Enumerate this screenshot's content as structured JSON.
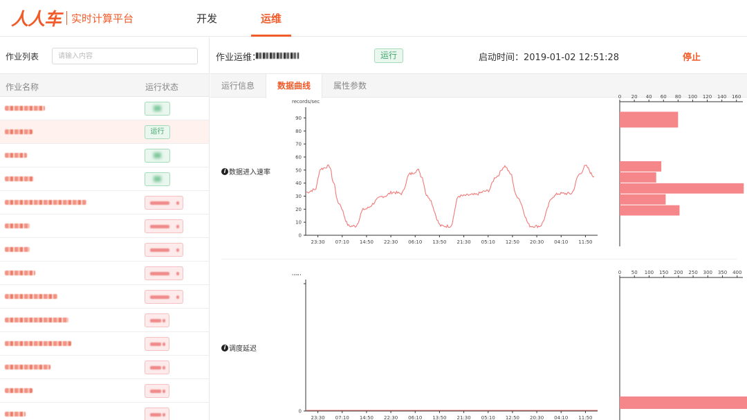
{
  "header": {
    "logo_mark": "人人车",
    "logo_text": "实时计算平台",
    "tabs": [
      {
        "label": "开发",
        "active": false
      },
      {
        "label": "运维",
        "active": true
      }
    ]
  },
  "sidebar": {
    "search_label": "作业列表",
    "search_placeholder": "请输入内容",
    "col_name": "作业名称",
    "col_status": "运行状态",
    "rows": [
      {
        "status": "running",
        "selected": false
      },
      {
        "status": "running",
        "label": "运行",
        "selected": true
      },
      {
        "status": "running",
        "selected": false
      },
      {
        "status": "running",
        "selected": false
      },
      {
        "status": "stopped",
        "selected": false
      },
      {
        "status": "stopped",
        "selected": false
      },
      {
        "status": "stopped",
        "selected": false
      },
      {
        "status": "stopped",
        "selected": false
      },
      {
        "status": "stopped",
        "selected": false
      },
      {
        "status": "stopped",
        "selected": false
      },
      {
        "status": "stopped",
        "selected": false
      },
      {
        "status": "stopped",
        "selected": false
      },
      {
        "status": "stopped",
        "selected": false
      },
      {
        "status": "stopped",
        "selected": false
      }
    ]
  },
  "job_info": {
    "title": "作业运维：",
    "status": "运行",
    "start_time": "启动时间：2019-01-02 12:51:28",
    "stop_label": "停止"
  },
  "sub_tabs": [
    {
      "label": "运行信息",
      "active": false
    },
    {
      "label": "数据曲线",
      "active": true
    },
    {
      "label": "属性参数",
      "active": false
    }
  ],
  "colors": {
    "accent": "#f05b2a",
    "line": "#f07878",
    "bar": "#f5868a",
    "success": "#3fa66b"
  },
  "chart_data": [
    {
      "type": "line",
      "title": "数据进入速率",
      "ylabel": "records/sec",
      "ylim": [
        0,
        95
      ],
      "yticks": [
        0,
        10,
        20,
        30,
        40,
        50,
        60,
        70,
        80,
        90
      ],
      "xticks": [
        "23:30",
        "07:10",
        "14:50",
        "22:30",
        "06:10",
        "13:50",
        "21:30",
        "05:10",
        "12:50",
        "20:30",
        "04:10",
        "11:50"
      ],
      "series": [
        {
          "x_keys": [
            0,
            3,
            5,
            8,
            9.5,
            11,
            15,
            17,
            20,
            27,
            30,
            33,
            36,
            39,
            40,
            42,
            47,
            50,
            53,
            58,
            63,
            66,
            69,
            71,
            73,
            78,
            81,
            86,
            87.5,
            92,
            95,
            97,
            100
          ],
          "values": [
            33,
            35,
            51,
            53,
            40,
            25,
            7,
            7,
            20,
            30,
            33,
            32,
            47,
            50,
            45,
            30,
            7,
            7,
            30,
            31,
            34,
            45,
            53,
            47,
            30,
            7,
            7,
            30,
            32,
            32,
            47,
            53,
            45
          ]
        }
      ]
    },
    {
      "type": "bar",
      "orientation": "horizontal",
      "xlim": [
        0,
        165
      ],
      "xticks": [
        0,
        20,
        40,
        60,
        80,
        100,
        120,
        140,
        160
      ],
      "y_bins": [
        [
          0,
          10
        ],
        [
          10,
          20
        ],
        [
          20,
          30
        ],
        [
          30,
          40
        ],
        [
          40,
          50
        ],
        [
          80,
          95
        ]
      ],
      "values": [
        82,
        63,
        170,
        50,
        57,
        80
      ]
    },
    {
      "type": "line",
      "title": "调度延迟",
      "ylabel": "min",
      "xticks": [
        "23:30",
        "07:10",
        "14:50",
        "22:30",
        "06:10",
        "13:50",
        "21:30",
        "05:10",
        "12:50",
        "20:30",
        "04:10",
        "11:50"
      ],
      "series": [
        {
          "values": [
            0,
            0
          ]
        }
      ]
    },
    {
      "type": "bar",
      "orientation": "horizontal",
      "xlim": [
        0,
        410
      ],
      "xticks": [
        0,
        50,
        100,
        150,
        200,
        250,
        300,
        350,
        400
      ],
      "values": [
        450
      ]
    }
  ]
}
